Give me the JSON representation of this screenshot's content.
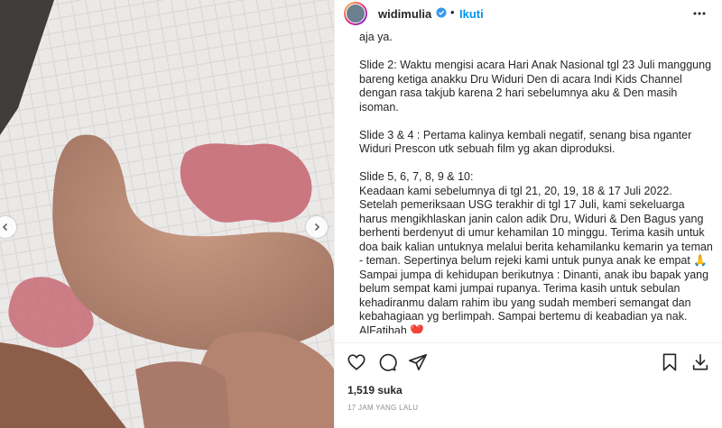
{
  "post": {
    "image_alt": "foot on patterned pad",
    "nav": {
      "prev_icon": "chevron-left-icon",
      "next_icon": "chevron-right-icon"
    }
  },
  "header": {
    "username": "widimulia",
    "dot": "•",
    "follow_label": "Ikuti",
    "verified_icon": "verified-badge-icon",
    "more_icon": "more-options-icon"
  },
  "caption": {
    "paragraphs": [
      "aja ya.",
      "Slide 2: Waktu mengisi acara Hari Anak Nasional tgl 23 Juli manggung bareng ketiga anakku Dru Widuri Den di acara Indi Kids Channel dengan rasa takjub karena 2 hari sebelumnya aku & Den masih isoman.",
      "Slide 3 & 4 : Pertama kalinya kembali negatif, senang bisa nganter Widuri Prescon utk sebuah film yg akan diproduksi.",
      "Slide 5, 6, 7, 8, 9 & 10:\nKeadaan kami sebelumnya di tgl 21, 20, 19, 18 & 17 Juli 2022. Setelah pemeriksaan USG terakhir di tgl 17 Juli, kami sekeluarga harus mengikhlaskan janin calon adik Dru, Widuri & Den Bagus yang berhenti berdenyut di umur kehamilan 10 minggu. Terima kasih untuk doa baik kalian untuknya melalui berita kehamilanku kemarin ya teman - teman. Sepertinya belum rejeki kami untuk punya anak ke empat 🙏 Sampai jumpa di kehidupan berikutnya : Dinanti, anak ibu bapak yang belum sempat kami jumpai rupanya. Terima kasih untuk sebulan kehadiranmu dalam rahim ibu yang sudah memberi semangat dan kebahagiaan yg berlimpah. Sampai bertemu di keabadian ya nak. AlFatihah ❤️"
    ]
  },
  "actions": {
    "like_icon": "heart-icon",
    "comment_icon": "comment-icon",
    "share_icon": "share-icon",
    "save_icon": "bookmark-icon",
    "download_icon": "download-icon"
  },
  "stats": {
    "likes": "1,519 suka",
    "time": "17 JAM YANG LALU"
  }
}
